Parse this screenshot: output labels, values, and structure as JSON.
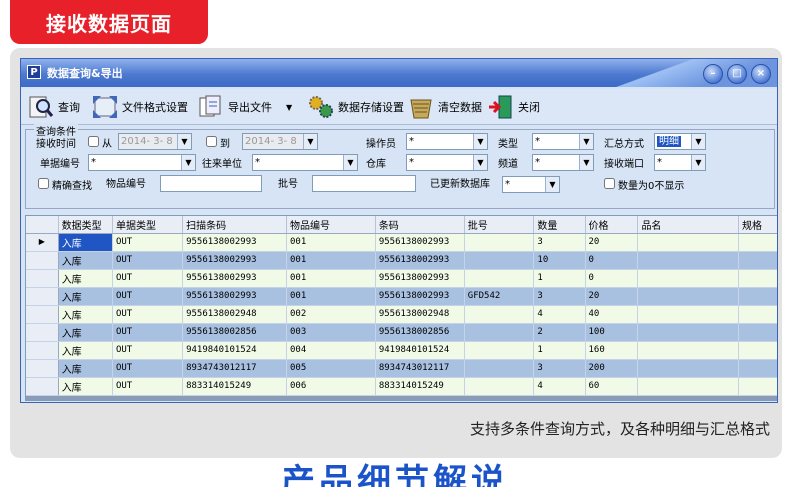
{
  "banner": {
    "title": "接收数据页面"
  },
  "window": {
    "title": "数据查询&导出",
    "app_letter": "P"
  },
  "toolbar": {
    "query": "查询",
    "file_format": "文件格式设置",
    "export": "导出文件",
    "storage": "数据存储设置",
    "clear": "清空数据",
    "close": "关闭"
  },
  "filter": {
    "legend": "查询条件",
    "receive_time_label": "接收时间",
    "from_label": "从",
    "from_value": "2014- 3- 8",
    "to_label": "到",
    "to_value": "2014- 3- 8",
    "operator_label": "操作员",
    "operator_value": "*",
    "type_label": "类型",
    "type_value": "*",
    "summary_label": "汇总方式",
    "summary_value": "明细",
    "doc_no_label": "单据编号",
    "doc_no_value": "*",
    "partner_label": "往来单位",
    "partner_value": "*",
    "warehouse_label": "仓库",
    "warehouse_value": "*",
    "channel_label": "频道",
    "channel_value": "*",
    "port_label": "接收端口",
    "port_value": "*",
    "exact_label": "精确查找",
    "item_no_label": "物品编号",
    "item_no_value": "",
    "batch_label": "批号",
    "batch_value": "",
    "updated_db_label": "已更新数据库",
    "updated_db_value": "*",
    "hide_zero_label": "数量为0不显示"
  },
  "table": {
    "columns": [
      "数据类型",
      "单据类型",
      "扫描条码",
      "物品编号",
      "条码",
      "批号",
      "数量",
      "价格",
      "品名",
      "规格"
    ],
    "rows": [
      [
        "入库",
        "OUT",
        "9556138002993",
        "001",
        "9556138002993",
        "",
        "3",
        "20",
        "",
        ""
      ],
      [
        "入库",
        "OUT",
        "9556138002993",
        "001",
        "9556138002993",
        "",
        "10",
        "0",
        "",
        ""
      ],
      [
        "入库",
        "OUT",
        "9556138002993",
        "001",
        "9556138002993",
        "",
        "1",
        "0",
        "",
        ""
      ],
      [
        "入库",
        "OUT",
        "9556138002993",
        "001",
        "9556138002993",
        "GFD542",
        "3",
        "20",
        "",
        ""
      ],
      [
        "入库",
        "OUT",
        "9556138002948",
        "002",
        "9556138002948",
        "",
        "4",
        "40",
        "",
        ""
      ],
      [
        "入库",
        "OUT",
        "9556138002856",
        "003",
        "9556138002856",
        "",
        "2",
        "100",
        "",
        ""
      ],
      [
        "入库",
        "OUT",
        "9419840101524",
        "004",
        "9419840101524",
        "",
        "1",
        "160",
        "",
        ""
      ],
      [
        "入库",
        "OUT",
        "8934743012117",
        "005",
        "8934743012117",
        "",
        "3",
        "200",
        "",
        ""
      ],
      [
        "入库",
        "OUT",
        "883314015249",
        "006",
        "883314015249",
        "",
        "4",
        "60",
        "",
        ""
      ]
    ]
  },
  "caption": "支持多条件查询方式，及各种明细与汇总格式",
  "footer": "产品细节解说",
  "colors": {
    "accent": "#e8202a",
    "title_blue": "#1b54c9",
    "row_blue": "#a9c1e1",
    "row_green": "#f0fae6"
  }
}
